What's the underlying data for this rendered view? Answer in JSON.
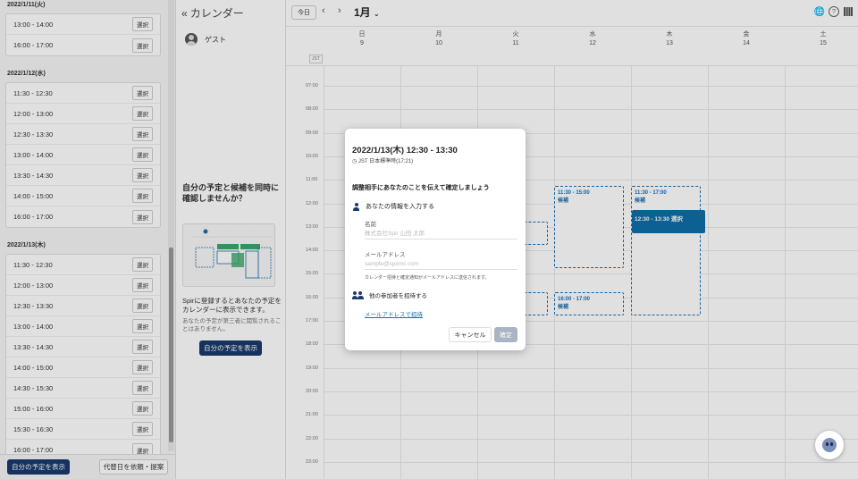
{
  "left_panel": {
    "days": [
      {
        "date": "2022/1/11(火)",
        "slots": [
          "13:00 - 14:00",
          "16:00 - 17:00"
        ]
      },
      {
        "date": "2022/1/12(水)",
        "slots": [
          "11:30 - 12:30",
          "12:00 - 13:00",
          "12:30 - 13:30",
          "13:00 - 14:00",
          "13:30 - 14:30",
          "14:00 - 15:00",
          "16:00 - 17:00"
        ]
      },
      {
        "date": "2022/1/13(木)",
        "slots": [
          "11:30 - 12:30",
          "12:00 - 13:00",
          "12:30 - 13:30",
          "13:00 - 14:00",
          "13:30 - 14:30",
          "14:00 - 15:00",
          "14:30 - 15:30",
          "15:00 - 16:00",
          "15:30 - 16:30",
          "16:00 - 17:00"
        ]
      }
    ],
    "select_label": "選択",
    "footer": {
      "show_my_schedule": "自分の予定を表示",
      "request_alt": "代替日を依頼・提案"
    }
  },
  "mid_panel": {
    "back_label": "«",
    "title": "カレンダー",
    "guest_name": "ゲスト",
    "promo_heading": "自分の予定と候補を同時に確認しませんか？",
    "promo_text": "Spirに登録するとあなたの予定をカレンダーに表示できます。",
    "promo_note": "あなたの予定が第三者に閲覧されることはありません。",
    "promo_button": "自分の予定を表示"
  },
  "calendar": {
    "today_label": "今日",
    "prev_label": "‹",
    "next_label": "›",
    "month": "1月",
    "tz_badge": "JST",
    "days": [
      {
        "dow": "日",
        "date": "9"
      },
      {
        "dow": "月",
        "date": "10"
      },
      {
        "dow": "火",
        "date": "11"
      },
      {
        "dow": "水",
        "date": "12"
      },
      {
        "dow": "木",
        "date": "13"
      },
      {
        "dow": "金",
        "date": "14"
      },
      {
        "dow": "土",
        "date": "15"
      }
    ],
    "hours": [
      "07:00",
      "08:00",
      "09:00",
      "10:00",
      "11:00",
      "12:00",
      "13:00",
      "14:00",
      "15:00",
      "16:00",
      "17:00",
      "18:00",
      "19:00",
      "20:00",
      "21:00",
      "22:00",
      "23:00"
    ],
    "events": {
      "wed_1": {
        "time": "11:30 - 15:00",
        "label": "候補"
      },
      "wed_2": {
        "time": "16:00 - 17:00",
        "label": "候補"
      },
      "thu_1": {
        "time": "11:30 - 17:00",
        "label": "候補"
      },
      "thu_selected": {
        "label": "12:30 - 13:30 選択"
      }
    }
  },
  "modal": {
    "title": "2022/1/13(木) 12:30 - 13:30",
    "timezone": "JST 日本標準時(17:21)",
    "heading": "調整相手にあなたのことを伝えて確定しましょう",
    "info_label": "あなたの情報を入力する",
    "name_label": "名前",
    "name_placeholder": "株式会社Spir 山田 太郎",
    "email_label": "メールアドレス",
    "email_placeholder": "sample@spirinc.com",
    "email_note": "カレンダー招待と確定通知がメールアドレスに送信されます。",
    "invite_label": "他の参加者を招待する",
    "invite_link": "メールアドレスで招待",
    "cancel": "キャンセル",
    "confirm": "確定"
  }
}
